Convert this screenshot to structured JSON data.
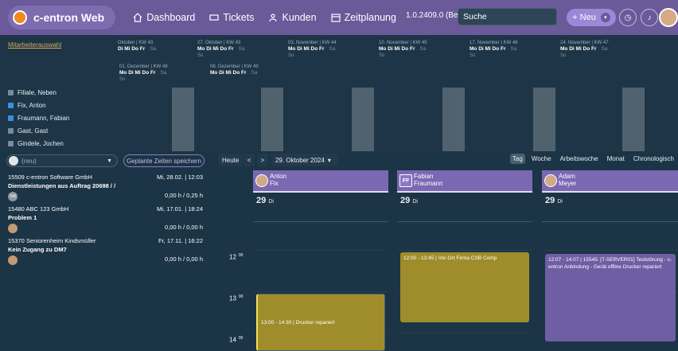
{
  "app": {
    "title": "c-entron Web",
    "version": "1.0.2409.0 (Beta)",
    "search_placeholder": "Suche",
    "new_label": "+ Neu"
  },
  "nav": [
    {
      "label": "Dashboard",
      "icon": "home-icon"
    },
    {
      "label": "Tickets",
      "icon": "ticket-icon"
    },
    {
      "label": "Kunden",
      "icon": "people-icon"
    },
    {
      "label": "Zeitplanung",
      "icon": "calendar-icon"
    }
  ],
  "planner": {
    "link": "Mitarbeiterauswahl",
    "weeks_row1": [
      {
        "label": "Oktober | KW 43",
        "days": "Di  Mi  Do  Fr",
        "weekend": "Sa",
        "weekend2": ""
      },
      {
        "label": "27. Oktober | KW 43",
        "days": "Mo  Di  Mi  Do  Fr",
        "weekend": "Sa",
        "weekend2": "So"
      },
      {
        "label": "03. November | KW 44",
        "days": "Mo  Di  Mi  Do  Fr",
        "weekend": "Sa",
        "weekend2": "So"
      },
      {
        "label": "10. November | KW 45",
        "days": "Mo  Di  Mi  Do  Fr",
        "weekend": "Sa",
        "weekend2": "So"
      },
      {
        "label": "17. November | KW 46",
        "days": "Mo  Di  Mi  Do  Fr",
        "weekend": "Sa",
        "weekend2": "So"
      },
      {
        "label": "24. November | KW 47",
        "days": "Mo  Di  Mi  Do  Fr",
        "weekend": "Sa",
        "weekend2": "So"
      }
    ],
    "weeks_row2": [
      {
        "label": "01. Dezember | KW 48",
        "days": "Mo  Di  Mi  Do  Fr",
        "weekend": "Sa",
        "weekend2": "So"
      },
      {
        "label": "08. Dezember | KW 49",
        "days": "Mo  Di  Mi  Do  Fr",
        "weekend": "Sa",
        "weekend2": ""
      }
    ],
    "employees": [
      {
        "name": "Filiale, Neben",
        "checked": false
      },
      {
        "name": "Fix, Anton",
        "checked": true
      },
      {
        "name": "Fraumann, Fabian",
        "checked": true
      },
      {
        "name": "Gast, Gast",
        "checked": false
      },
      {
        "name": "Gindele, Jochen",
        "checked": false
      }
    ]
  },
  "left": {
    "select_value": "(neu)",
    "save_label": "Geplante Zeiten speichern",
    "tickets": [
      {
        "company": "15509 c-entron Software GmbH",
        "date": "Mi, 28.02. | 12:03",
        "title": "Dienstleistungen aus Auftrag 20698 / /",
        "hours": "0,00 h / 0,25 h",
        "badge": "SM"
      },
      {
        "company": "15480 ABC 123 GmbH",
        "date": "Mi, 17.01. | 18:24",
        "title": "Problem 1",
        "hours": "0,00 h / 0,00 h",
        "badge": ""
      },
      {
        "company": "15370 Seniorenheim Kindsmüller",
        "date": "Fr, 17.11. | 16:22",
        "title": "Kein Zugang zu DM7",
        "hours": "0,00 h / 0,00 h",
        "badge": ""
      }
    ]
  },
  "calendar": {
    "today_label": "Heute",
    "date_label": "29. Oktober 2024",
    "views": [
      "Tag",
      "Woche",
      "Arbeitswoche",
      "Monat",
      "Chronologisch"
    ],
    "active_view": "Tag",
    "hours": [
      "12",
      "13",
      "14"
    ],
    "minutes": "00",
    "columns": [
      {
        "first": "Anton",
        "last": "Fix",
        "initials": "",
        "day": "29",
        "dow": "Di"
      },
      {
        "first": "Fabian",
        "last": "Fraumann",
        "initials": "FF",
        "day": "29",
        "dow": "Di"
      },
      {
        "first": "Adam",
        "last": "Meyer",
        "initials": "",
        "day": "29",
        "dow": "Di"
      }
    ],
    "events": [
      {
        "text": "13:00 - 14:30 | Drucker repariert"
      },
      {
        "text": "12:00 - 13:45 | Vor-Ort Firma CSB Comp"
      },
      {
        "text": "12:07 - 14:07 | 15545: [T-SERVER01] Teststörung - c-entron Anbindung - Gerät offline Drucker repariert"
      }
    ]
  },
  "colors": {
    "topbar": "#6a5a9a",
    "background": "#1b3446",
    "event_gold": "#9f8d2b",
    "event_purple": "#6f5ea3",
    "accent": "#3d8de8"
  }
}
